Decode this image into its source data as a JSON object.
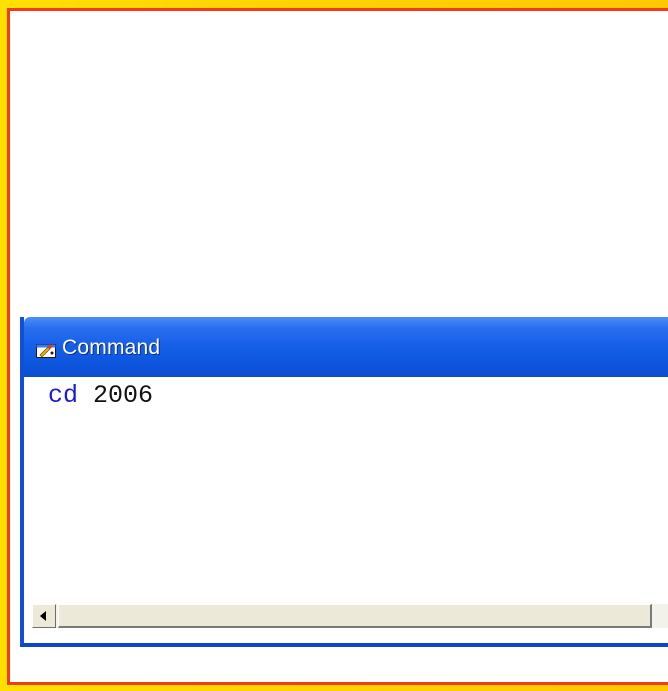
{
  "command_window": {
    "title": "Command",
    "icon": "command-window-icon",
    "lines": [
      {
        "keyword": "cd",
        "argument": "2006"
      }
    ]
  },
  "colors": {
    "frame_outer": "#ffd400",
    "frame_border": "#f43b12",
    "titlebar": "#1760e8",
    "keyword": "#1a1ad6"
  }
}
